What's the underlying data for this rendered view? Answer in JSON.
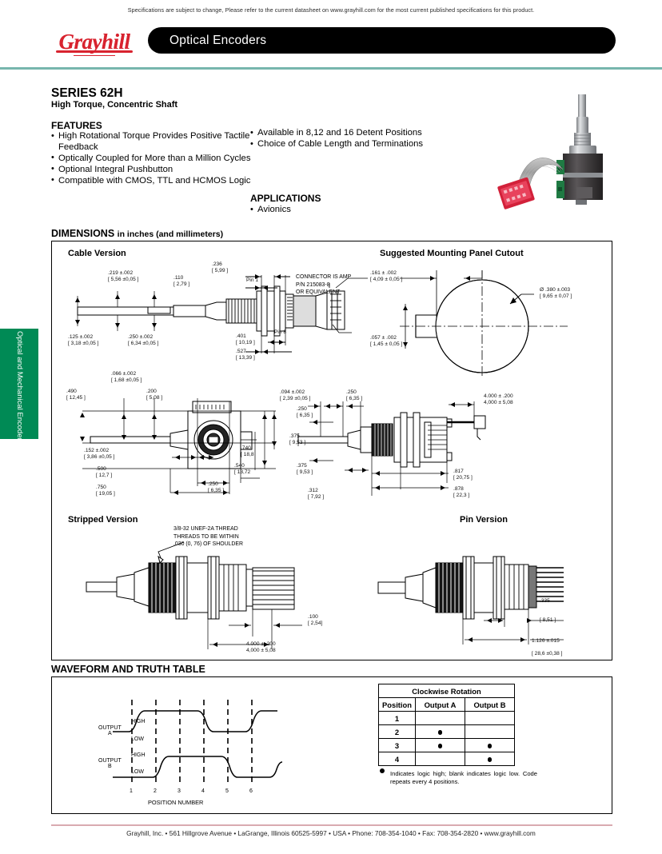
{
  "notice": "Specifications are subject to change, Please refer to the current datasheet on www.grayhill.com for the most current published specifications for this product.",
  "header": {
    "logo_text": "Grayhill",
    "bar_title": "Optical Encoders"
  },
  "sidetab": {
    "label": "Optical and Mechanical Encoders",
    "color": "#008a55"
  },
  "title": {
    "series": "SERIES 62H",
    "subtitle": "High Torque, Concentric Shaft"
  },
  "features": {
    "heading": "FEATURES",
    "left": [
      "High Rotational Torque Provides Positive Tactile Feedback",
      "Optically Coupled for More than a Million Cycles",
      "Optional Integral Pushbutton",
      "Compatible with CMOS, TTL and HCMOS Logic"
    ],
    "right": [
      "Available in 8,12 and 16 Detent Positions",
      "Choice of Cable Length and Terminations"
    ]
  },
  "applications": {
    "heading": "APPLICATIONS",
    "items": [
      "Avionics"
    ]
  },
  "dimensions": {
    "heading": "DIMENSIONS",
    "heading_sub": "in inches (and millimeters)",
    "cable_version": {
      "title": "Cable Version",
      "labels": [
        {
          "t": ".219  ±.002",
          "t2": "[ 5,56  ±0,05  ]"
        },
        {
          "t": ".110",
          "t2": "[ 2,79 ]"
        },
        {
          "t": ".236",
          "t2": "[ 5,99  ]"
        },
        {
          "t": ".125  ±.002",
          "t2": "[ 3,18  ±0,05  ]"
        },
        {
          "t": ".250  ±.002",
          "t2": "[ 6,34  ±0,05  ]"
        },
        {
          "t": ".401",
          "t2": "[ 10,19 ]"
        },
        {
          "t": ".527",
          "t2": "[ 13,39  ]"
        }
      ],
      "pin1": "Pin 1",
      "pin8": "Pin 8",
      "connector_note": [
        "CONNECTOR IS AMP",
        "P/N 215083-8",
        "OR EQUIVALENT"
      ]
    },
    "panel_cutout": {
      "title": "Suggested Mounting Panel Cutout",
      "labels": [
        {
          "t": ".161 ± .002",
          "t2": "[ 4,09 ± 0,05 ]"
        },
        {
          "t": ".057 ± .002",
          "t2": "[ 1,45 ± 0,05 ]"
        },
        {
          "t": "Ø .380 ±.003",
          "t2": "[ 9,65 ± 0,07 ]"
        }
      ]
    },
    "mid_left": {
      "labels": [
        {
          "t": ".066  ±.002",
          "t2": "[ 1,68  ±0,05  ]"
        },
        {
          "t": ".490",
          "t2": "[ 12,45  ]"
        },
        {
          "t": ".200",
          "t2": "[ 5,08  ]"
        },
        {
          "t": ".152  ±.002",
          "t2": "[ 3,86  ±0,05  ]"
        },
        {
          "t": ".500",
          "t2": "[ 12,7  ]"
        },
        {
          "t": ".750",
          "t2": "[ 19,05  ]"
        },
        {
          "t": ".740",
          "t2": "[ 18,8"
        },
        {
          "t": ".540",
          "t2": "[ 13,72"
        },
        {
          "t": ".250",
          "t2": "[ 6,35  ]"
        }
      ]
    },
    "mid_right": {
      "labels": [
        {
          "t": ".094  ±.002",
          "t2": "[ 2,39  ±0,05  ]"
        },
        {
          "t": ".250",
          "t2": "[ 6,35  ]"
        },
        {
          "t": ".250",
          "t2": "[ 6,35  ]"
        },
        {
          "t": ".375",
          "t2": "[ 9,53  ]"
        },
        {
          "t": ".375",
          "t2": "[ 9,53  ]"
        },
        {
          "t": ".312",
          "t2": "[ 7,92  ]"
        },
        {
          "t": ".817",
          "t2": "[ 20,75  ]"
        },
        {
          "t": ".878",
          "t2": "[ 22,3  ]"
        },
        {
          "t": "4.000 ± .200",
          "t2": "4,000 ± 5,08"
        }
      ]
    },
    "stripped_version": {
      "title": "Stripped Version",
      "note": [
        "3/8-32 UNEF-2A THREAD",
        "THREADS TO BE WITHIN",
        ".030 (0, 76) OF SHOULDER"
      ],
      "labels": [
        {
          "t": ".100",
          "t2": "[ 2,54]"
        },
        {
          "t": "4.000 ± .200",
          "t2": "4,000 ± 5,08"
        }
      ]
    },
    "pin_version": {
      "title": "Pin Version",
      "labels": [
        {
          "t": ".335",
          "t2": "[ 8,51 ]"
        },
        {
          "t": "1.126   ±.015",
          "t2": "[ 28,6   ±0,38 ]"
        }
      ]
    }
  },
  "waveform": {
    "heading": "WAVEFORM AND TRUTH TABLE",
    "output_a": "OUTPUT",
    "output_a2": "A",
    "output_b": "OUTPUT",
    "output_b2": "B",
    "high": "HIGH",
    "low": "LOW",
    "positions": [
      "1",
      "2",
      "3",
      "4",
      "5",
      "6"
    ],
    "xlabel": "POSITION NUMBER"
  },
  "truth_table": {
    "title": "Clockwise Rotation",
    "columns": [
      "Position",
      "Output A",
      "Output B"
    ],
    "rows": [
      {
        "position": "1",
        "a": false,
        "b": false
      },
      {
        "position": "2",
        "a": true,
        "b": false
      },
      {
        "position": "3",
        "a": true,
        "b": true
      },
      {
        "position": "4",
        "a": false,
        "b": true
      }
    ],
    "note": "Indicates logic high; blank indicates logic low. Code repeats every 4 positions."
  },
  "footer": "Grayhill,  Inc.  •  561  Hillgrove  Avenue  •  LaGrange,  Illinois    60525-5997  •  USA  •  Phone:  708-354-1040  •  Fax:  708-354-2820  •  www.grayhill.com"
}
